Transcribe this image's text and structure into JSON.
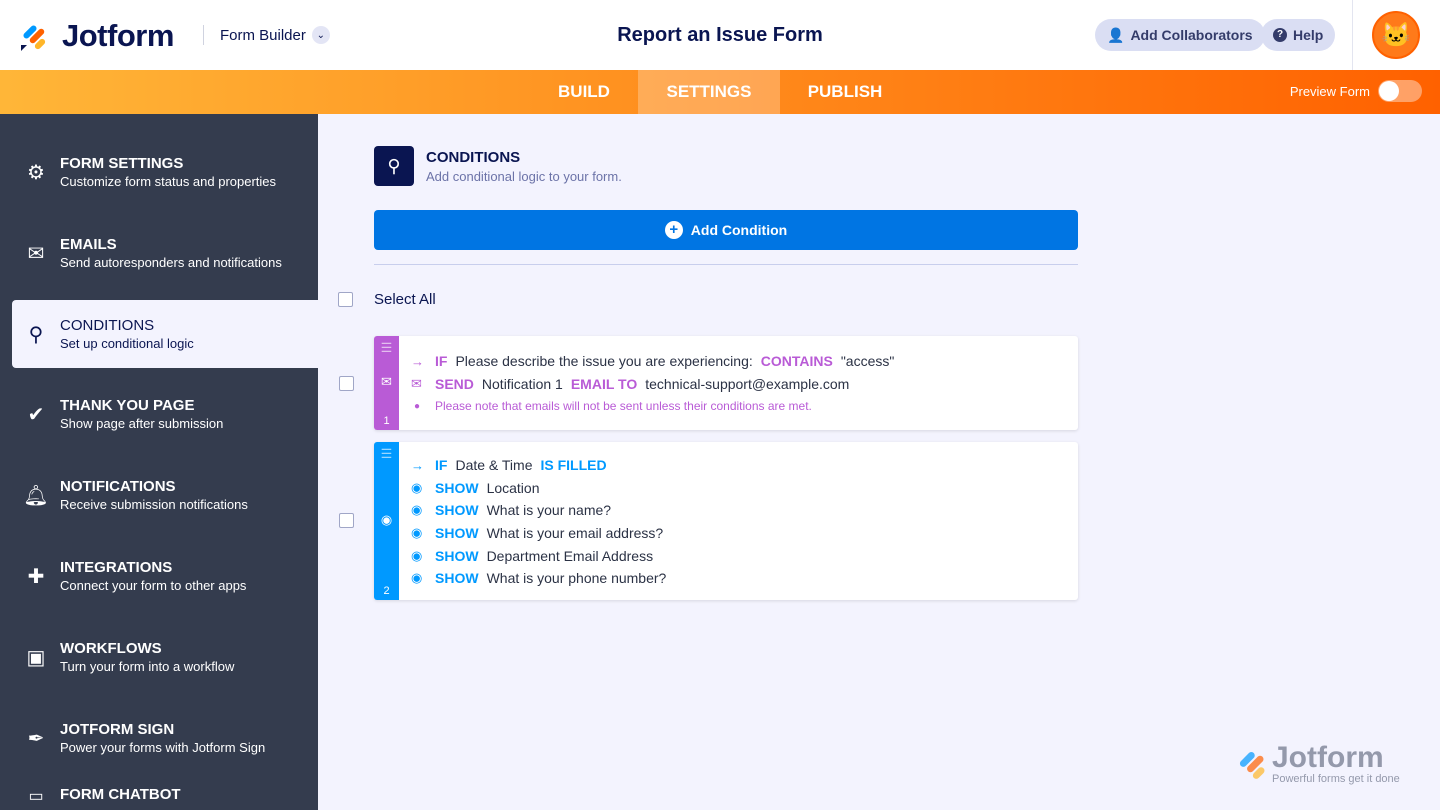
{
  "header": {
    "brand": "Jotform",
    "product": "Form Builder",
    "form_title": "Report an Issue Form",
    "add_collaborators": "Add Collaborators",
    "help": "Help"
  },
  "nav": {
    "tabs": [
      "BUILD",
      "SETTINGS",
      "PUBLISH"
    ],
    "active": "SETTINGS",
    "preview": "Preview Form",
    "preview_on": false
  },
  "sidebar": {
    "items": [
      {
        "title": "FORM SETTINGS",
        "sub": "Customize form status and properties",
        "icon": "gear-icon"
      },
      {
        "title": "EMAILS",
        "sub": "Send autoresponders and notifications",
        "icon": "envelope-icon"
      },
      {
        "title": "CONDITIONS",
        "sub": "Set up conditional logic",
        "icon": "hierarchy-icon"
      },
      {
        "title": "THANK YOU PAGE",
        "sub": "Show page after submission",
        "icon": "check-circle-icon"
      },
      {
        "title": "NOTIFICATIONS",
        "sub": "Receive submission notifications",
        "icon": "bell-icon"
      },
      {
        "title": "INTEGRATIONS",
        "sub": "Connect your form to other apps",
        "icon": "puzzle-icon"
      },
      {
        "title": "WORKFLOWS",
        "sub": "Turn your form into a workflow",
        "icon": "workflow-icon"
      },
      {
        "title": "JOTFORM SIGN",
        "sub": "Power your forms with Jotform Sign",
        "icon": "pen-icon"
      },
      {
        "title": "FORM CHATBOT",
        "sub": "",
        "icon": "chatbot-icon"
      }
    ]
  },
  "main": {
    "title": "CONDITIONS",
    "subtitle": "Add conditional logic to your form.",
    "add_button": "Add Condition",
    "select_all": "Select All"
  },
  "conditions": [
    {
      "number": "1",
      "color": "#b95bd6",
      "rows": [
        {
          "kw": "IF",
          "field": "Please describe the issue you are experiencing:",
          "op": "CONTAINS",
          "val": "\"access\""
        },
        {
          "kw": "SEND",
          "field": "Notification 1",
          "op": "EMAIL TO",
          "val": "technical-support@example.com"
        },
        {
          "note": "Please note that emails will not be sent unless their conditions are met."
        }
      ]
    },
    {
      "number": "2",
      "color": "#0099ff",
      "rows": [
        {
          "kw": "IF",
          "field": "Date & Time",
          "op": "IS FILLED"
        },
        {
          "kw": "SHOW",
          "field": "Location"
        },
        {
          "kw": "SHOW",
          "field": "What is your name?"
        },
        {
          "kw": "SHOW",
          "field": "What is your email address?"
        },
        {
          "kw": "SHOW",
          "field": "Department Email Address"
        },
        {
          "kw": "SHOW",
          "field": "What is your phone number?"
        }
      ]
    }
  ],
  "watermark": {
    "brand": "Jotform",
    "tagline": "Powerful forms get it done"
  }
}
